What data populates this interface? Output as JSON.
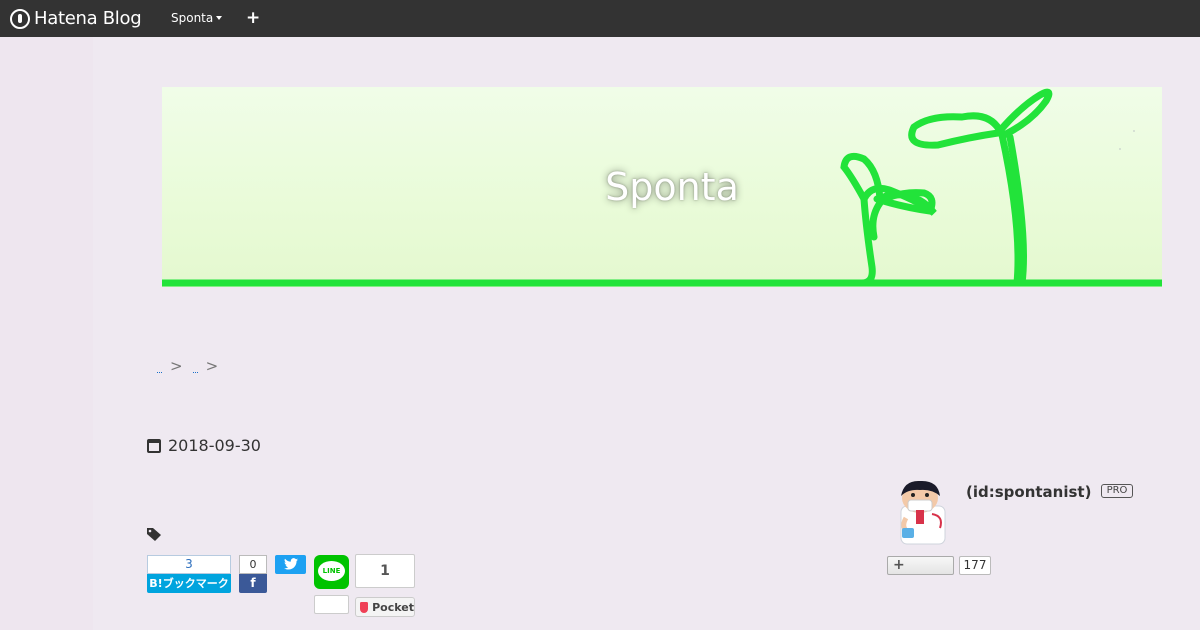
{
  "navbar": {
    "logo_text": "Hatena Blog",
    "blog_menu_label": "Sponta",
    "add_label": "+"
  },
  "header": {
    "title": "Sponta"
  },
  "breadcrumb": {
    "separator": ">"
  },
  "entry": {
    "date": "2018-09-30"
  },
  "share": {
    "hatena_bookmark": {
      "count": "3",
      "label": "B!ブックマーク"
    },
    "facebook": {
      "count": "0",
      "label": "f"
    },
    "line": {
      "label": "LINE"
    },
    "pocket": {
      "count": "1",
      "label": "Pocket"
    }
  },
  "author": {
    "id": "(id:spontanist)",
    "badge": "PRO",
    "follow_label": "+",
    "follower_count": "177"
  },
  "colors": {
    "navbar": "#333333",
    "background": "#efe9f1",
    "rope_green": "#22e33a",
    "hatena_blue": "#00a4de",
    "facebook_blue": "#3b5998",
    "twitter_blue": "#1da1f2",
    "line_green": "#00c300",
    "pocket_red": "#ef4056"
  }
}
